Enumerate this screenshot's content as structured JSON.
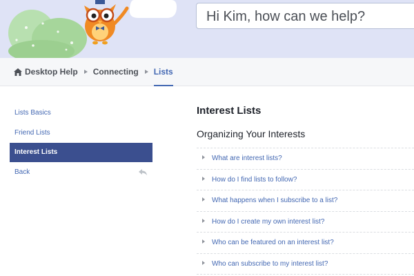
{
  "search": {
    "placeholder": "Hi Kim, how can we help?"
  },
  "breadcrumb": {
    "items": [
      {
        "label": "Desktop Help",
        "icon": "home-icon"
      },
      {
        "label": "Connecting"
      },
      {
        "label": "Lists",
        "active": true
      }
    ]
  },
  "sidebar": {
    "items": [
      {
        "label": "Lists Basics"
      },
      {
        "label": "Friend Lists"
      },
      {
        "label": "Interest Lists",
        "selected": true
      },
      {
        "label": "Back",
        "icon": "back-arrow-icon"
      }
    ]
  },
  "main": {
    "title": "Interest Lists",
    "section_title": "Organizing Your Interests",
    "questions": [
      "What are interest lists?",
      "How do I find lists to follow?",
      "What happens when I subscribe to a list?",
      "How do I create my own interest list?",
      "Who can be featured on an interest list?",
      "Who can subscribe to my interest list?"
    ]
  },
  "colors": {
    "banner_bg": "#dfe3f6",
    "link": "#4267b2",
    "selected_bg": "#3b4f8f"
  }
}
